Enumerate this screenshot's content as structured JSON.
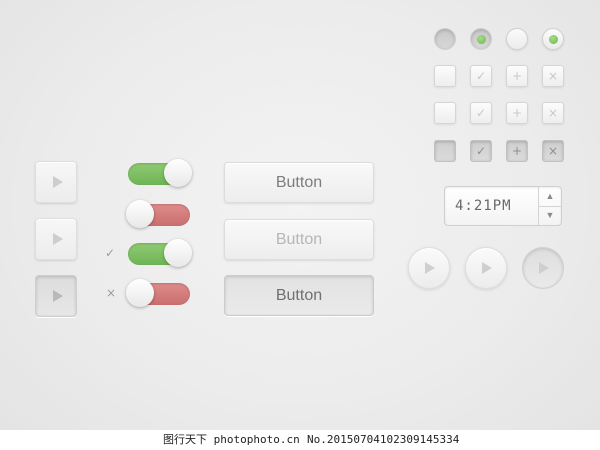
{
  "colors": {
    "toggle_on": "#7cbf62",
    "toggle_off": "#d47c7c",
    "radio_dot": "#6bb54c"
  },
  "play_squares": [
    {
      "icon": "play-icon",
      "state": "normal"
    },
    {
      "icon": "play-icon",
      "state": "normal"
    },
    {
      "icon": "play-icon",
      "state": "pressed"
    }
  ],
  "toggles": [
    {
      "state": "on"
    },
    {
      "state": "off"
    },
    {
      "state": "on",
      "mark": "✓"
    },
    {
      "state": "off",
      "mark": "×"
    }
  ],
  "buttons": [
    {
      "label": "Button",
      "state": "normal"
    },
    {
      "label": "Button",
      "state": "disabled"
    },
    {
      "label": "Button",
      "state": "pressed"
    }
  ],
  "radios": [
    {
      "state": "pressed-unselected"
    },
    {
      "state": "pressed-selected"
    },
    {
      "state": "unselected"
    },
    {
      "state": "selected"
    }
  ],
  "checkbox_rows": [
    {
      "state": "normal",
      "glyphs": [
        "",
        "✓",
        "+",
        "×"
      ]
    },
    {
      "state": "light",
      "glyphs": [
        "",
        "✓",
        "+",
        "×"
      ]
    },
    {
      "state": "pressed",
      "glyphs": [
        "",
        "✓",
        "+",
        "×"
      ]
    }
  ],
  "time_stepper": {
    "value": "4:21PM",
    "up_icon": "▲",
    "down_icon": "▼"
  },
  "round_play_buttons": [
    {
      "icon": "play-icon",
      "state": "normal"
    },
    {
      "icon": "play-icon",
      "state": "normal"
    },
    {
      "icon": "play-icon",
      "state": "pressed"
    }
  ],
  "watermark": {
    "left": "图行天下 photophoto.cn",
    "right": "No.20150704102309145334"
  }
}
